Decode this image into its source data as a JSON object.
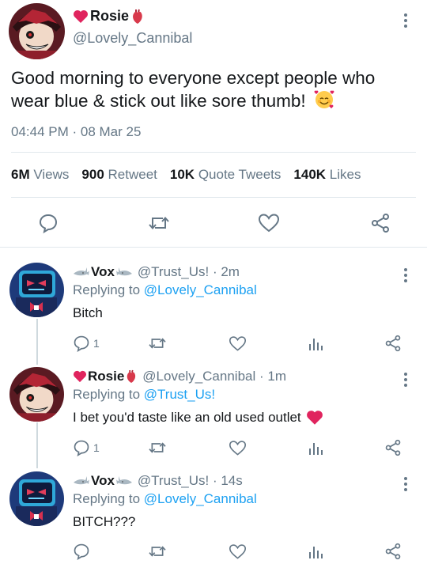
{
  "main_tweet": {
    "display_name": "Rosie",
    "handle": "@Lovely_Cannibal",
    "text": "Good morning to everyone except people who wear blue & stick out like sore thumb!",
    "time": "04:44 PM · 08 Mar 25",
    "stats": {
      "views_count": "6M",
      "views_label": "Views",
      "retweets_count": "900",
      "retweets_label": "Retweet",
      "quotes_count": "10K",
      "quotes_label": "Quote Tweets",
      "likes_count": "140K",
      "likes_label": "Likes"
    }
  },
  "replies": [
    {
      "display_name": "Vox",
      "handle": "@Trust_Us!",
      "time": "· 2m",
      "replying_label": "Replying to",
      "replying_to": "@Lovely_Cannibal",
      "text": "Bitch",
      "reply_count": "1"
    },
    {
      "display_name": "Rosie",
      "handle": "@Lovely_Cannibal",
      "time": "· 1m",
      "replying_label": "Replying to",
      "replying_to": "@Trust_Us!",
      "text": "I bet you'd taste like an old used outlet",
      "reply_count": "1"
    },
    {
      "display_name": "Vox",
      "handle": "@Trust_Us!",
      "time": "· 14s",
      "replying_label": "Replying to",
      "replying_to": "@Lovely_Cannibal",
      "text": "BITCH???",
      "reply_count": ""
    }
  ],
  "colors": {
    "accent": "#1da1f2",
    "muted": "#657786",
    "heart_red": "#e0245e",
    "divider": "#e1e8ed"
  },
  "icons": [
    "heart-emoji-icon",
    "anatomical-heart-icon",
    "shark-icon",
    "smiling-face-with-hearts-icon",
    "more-icon",
    "reply-icon",
    "retweet-icon",
    "like-icon",
    "share-icon",
    "analytics-icon"
  ]
}
